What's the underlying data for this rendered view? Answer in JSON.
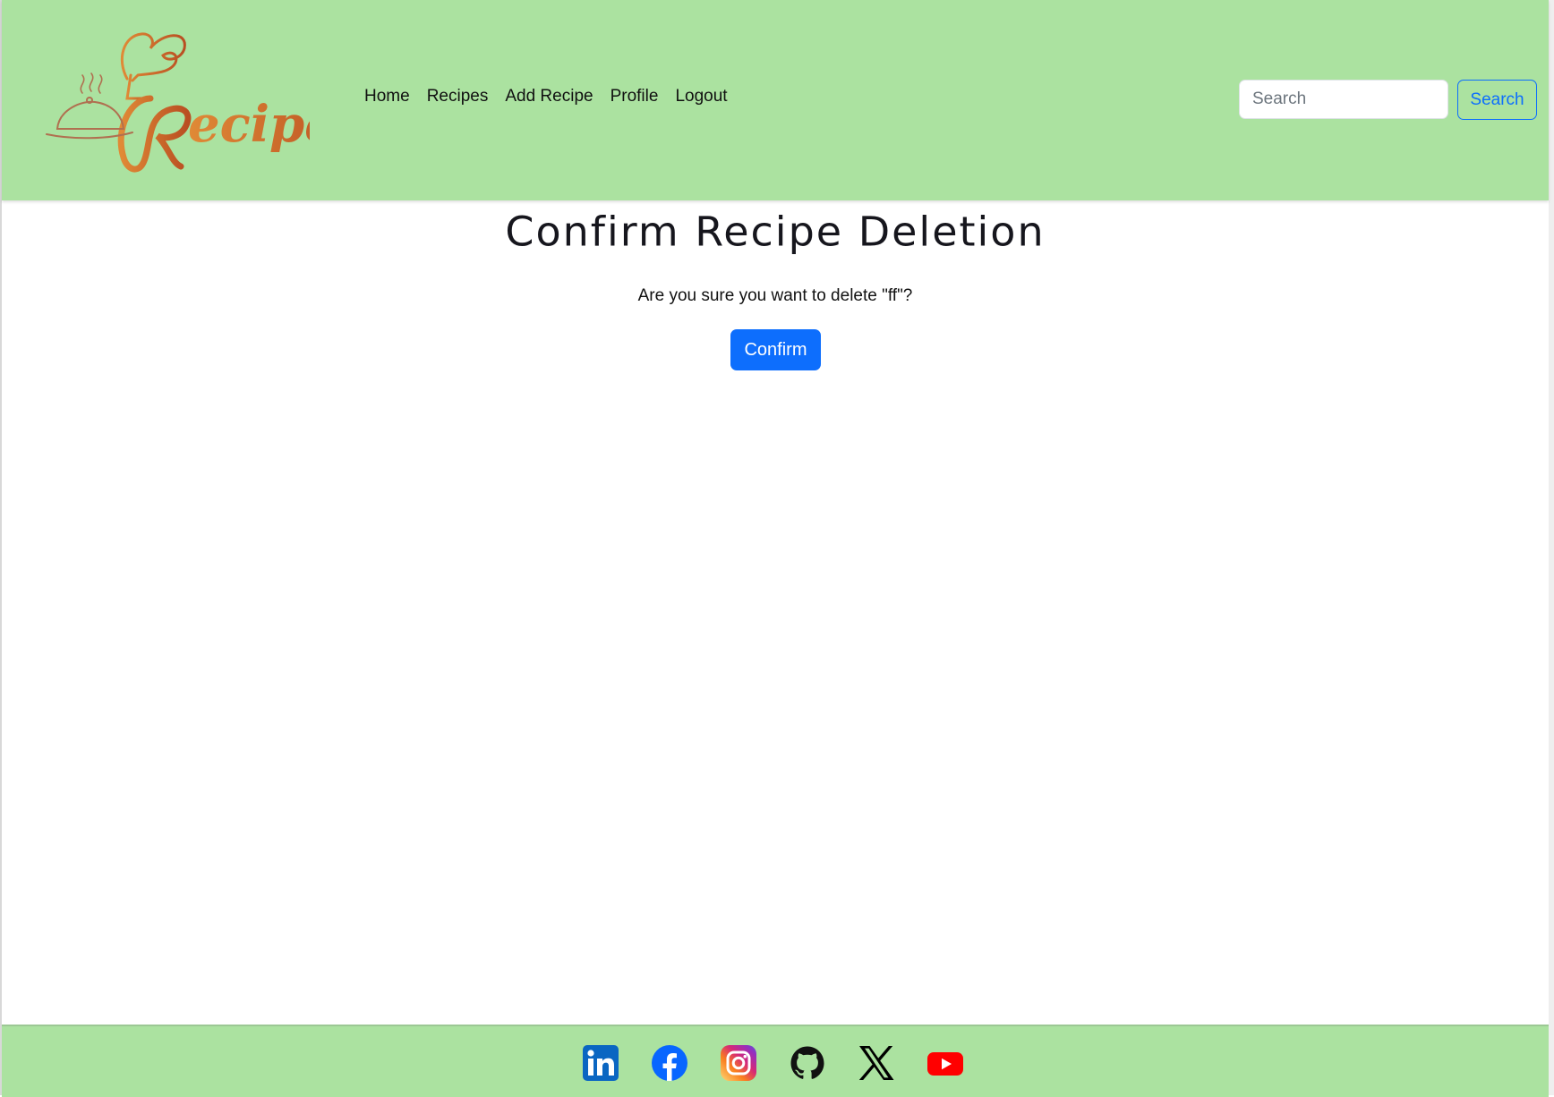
{
  "brand": {
    "logo_text": "Recipes",
    "logo_color": "#c8612b",
    "header_bg": "#abe2a0",
    "accent": "#0d6efd"
  },
  "nav": {
    "items": [
      {
        "label": "Home"
      },
      {
        "label": "Recipes"
      },
      {
        "label": "Add Recipe"
      },
      {
        "label": "Profile"
      },
      {
        "label": "Logout"
      }
    ]
  },
  "search": {
    "placeholder": "Search",
    "button_label": "Search"
  },
  "main": {
    "title": "Confirm Recipe Deletion",
    "message": "Are you sure you want to delete \"ff\"?",
    "confirm_label": "Confirm"
  },
  "footer": {
    "social_icons": [
      "linkedin-icon",
      "facebook-icon",
      "instagram-icon",
      "github-icon",
      "x-icon",
      "youtube-icon"
    ]
  }
}
